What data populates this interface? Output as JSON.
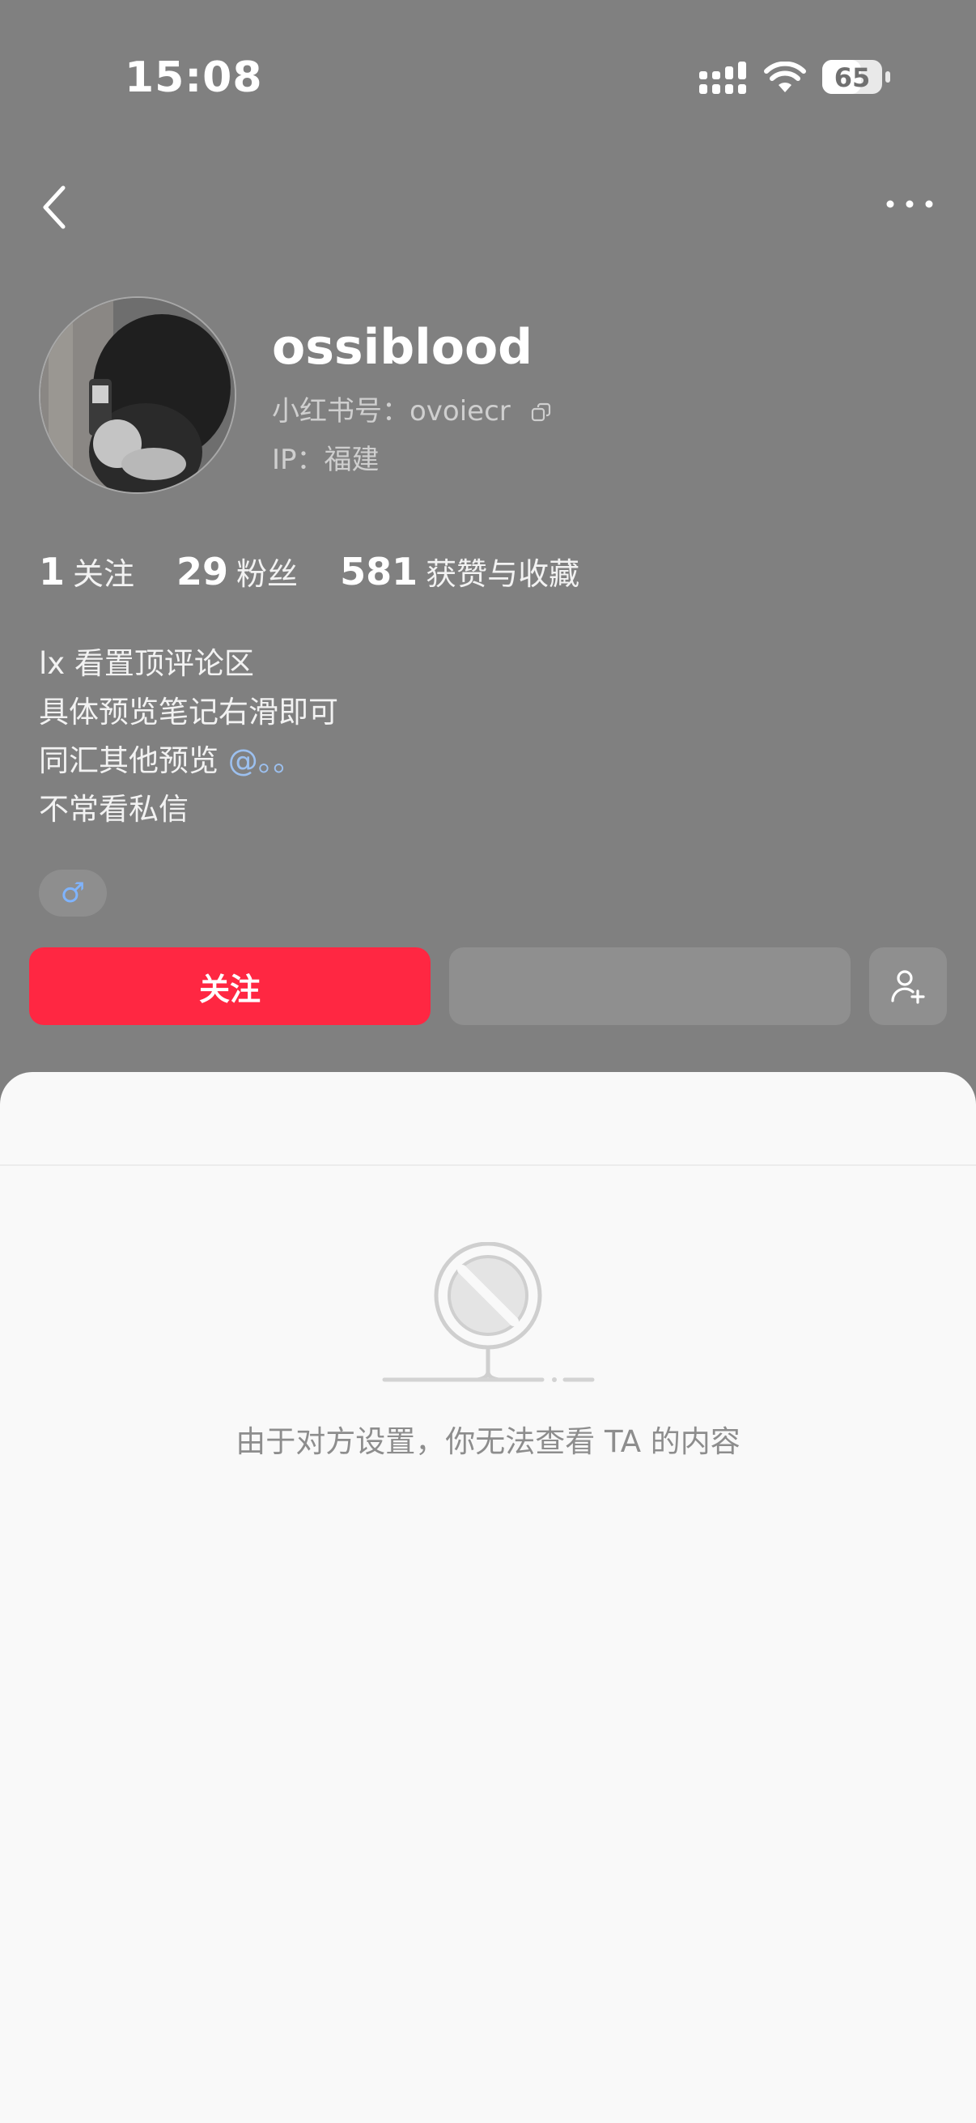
{
  "status_bar": {
    "time": "15:08",
    "battery_level": "65",
    "battery_fraction": 0.65,
    "icons": [
      "cellular-signal-icon",
      "wifi-icon",
      "battery-icon"
    ]
  },
  "nav": {
    "back_icon": "chevron-left-icon",
    "more_icon": "more-dots-icon"
  },
  "profile": {
    "name": "ossiblood",
    "id_line": "小红书号：ovoiecr",
    "ip_line": "IP：福建",
    "stats": [
      {
        "value": "1",
        "label": "关注"
      },
      {
        "value": "29",
        "label": "粉丝"
      },
      {
        "value": "581",
        "label": "获赞与收藏"
      }
    ],
    "bio": {
      "line1": "lx 看置顶评论区",
      "line2": "具体预览笔记右滑即可",
      "line3_prefix": "同汇其他预览 ",
      "line3_mention": "@。。",
      "line4": "不常看私信"
    },
    "gender_symbol": "♂"
  },
  "actions": {
    "follow_label": "关注",
    "add_friend_icon": "add-user-icon"
  },
  "content": {
    "empty_message": "由于对方设置，你无法查看 TA 的内容"
  },
  "colors": {
    "background": "#808080",
    "follow_button": "#ff2742",
    "panel": "#f9f9f9",
    "mention": "#9cc0ef",
    "gender_badge_symbol": "#7fb4ff"
  }
}
